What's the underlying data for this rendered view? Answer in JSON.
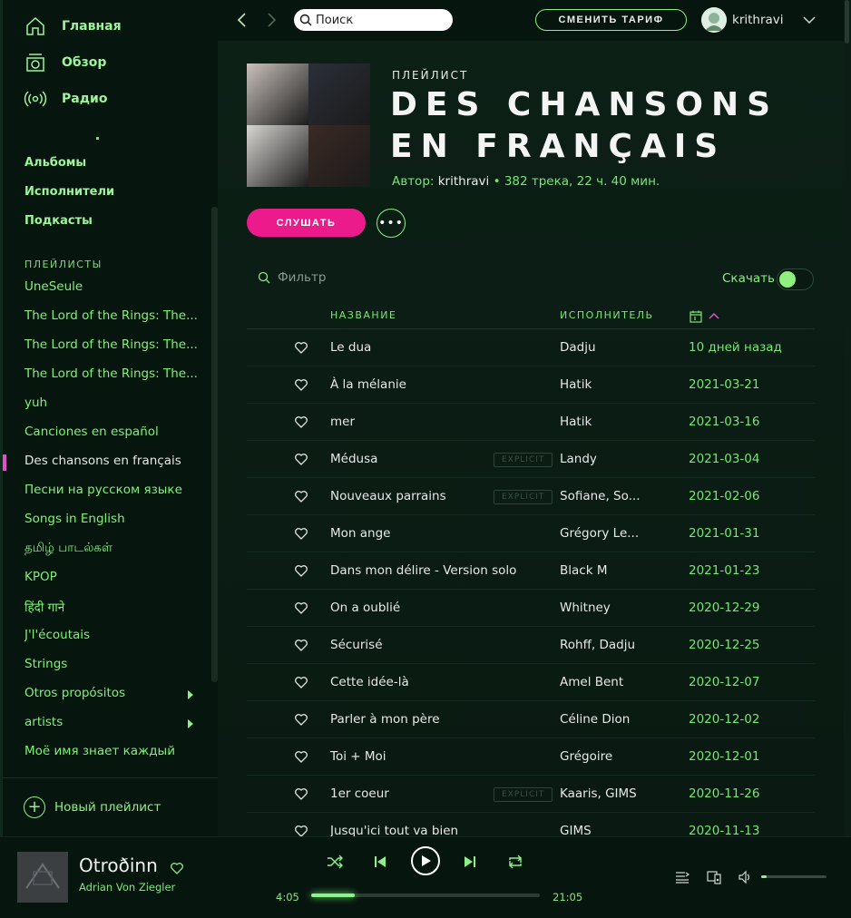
{
  "nav": {
    "home": "Главная",
    "browse": "Обзор",
    "radio": "Радио"
  },
  "library": {
    "albums": "Альбомы",
    "artists": "Исполнители",
    "podcasts": "Подкасты"
  },
  "playlists_label": "ПЛЕЙЛИСТЫ",
  "playlists": [
    {
      "label": "UneSeule"
    },
    {
      "label": "The Lord of the Rings: The..."
    },
    {
      "label": "The Lord of the Rings: The..."
    },
    {
      "label": "The Lord of the Rings: The..."
    },
    {
      "label": "yuh"
    },
    {
      "label": "Canciones en español"
    },
    {
      "label": "Des chansons en français",
      "active": true
    },
    {
      "label": "Песни на русском языке"
    },
    {
      "label": "Songs in English"
    },
    {
      "label": "தமிழ் பாடல்கள்"
    },
    {
      "label": "KPOP"
    },
    {
      "label": "हिंदी गाने"
    },
    {
      "label": "J'l'écoutais"
    },
    {
      "label": "Strings"
    },
    {
      "label": "Otros propósitos",
      "folder": true
    },
    {
      "label": "artists",
      "folder": true
    },
    {
      "label": "Моё имя знает каждый"
    }
  ],
  "new_playlist": "Новый плейлист",
  "topbar": {
    "search_placeholder": "Поиск",
    "upgrade": "СМЕНИТЬ ТАРИФ",
    "username": "krithravi"
  },
  "playlist": {
    "kicker": "ПЛЕЙЛИСТ",
    "title": "DES CHANSONS EN FRANÇAIS",
    "author_label": "Автор:",
    "owner": "krithravi",
    "meta_rest": "• 382 трека, 22 ч. 40 мин.",
    "play": "СЛУШАТЬ",
    "filter_placeholder": "Фильтр",
    "download_label": "Скачать",
    "download_on": true,
    "cover_colors": [
      "#c9c1bb",
      "#2a2f38",
      "#d8d6d2",
      "#3a2a24"
    ]
  },
  "columns": {
    "title": "НАЗВАНИЕ",
    "artist": "ИСПОЛНИТЕЛЬ"
  },
  "tracks": [
    {
      "title": "Le dua",
      "artist": "Dadju",
      "date": "10 дней назад",
      "explicit": false
    },
    {
      "title": "À la mélanie",
      "artist": "Hatik",
      "date": "2021-03-21",
      "explicit": false
    },
    {
      "title": "mer",
      "artist": "Hatik",
      "date": "2021-03-16",
      "explicit": false
    },
    {
      "title": "Médusa",
      "artist": "Landy",
      "date": "2021-03-04",
      "explicit": true
    },
    {
      "title": "Nouveaux parrains",
      "artist": "Sofiane, So...",
      "date": "2021-02-06",
      "explicit": true
    },
    {
      "title": "Mon ange",
      "artist": "Grégory Le...",
      "date": "2021-01-31",
      "explicit": false
    },
    {
      "title": "Dans mon délire - Version solo",
      "artist": "Black M",
      "date": "2021-01-23",
      "explicit": false
    },
    {
      "title": "On a oublié",
      "artist": "Whitney",
      "date": "2020-12-29",
      "explicit": false
    },
    {
      "title": "Sécurisé",
      "artist": "Rohff, Dadju",
      "date": "2020-12-25",
      "explicit": false
    },
    {
      "title": "Cette idée-là",
      "artist": "Amel Bent",
      "date": "2020-12-07",
      "explicit": false
    },
    {
      "title": "Parler à mon père",
      "artist": "Céline Dion",
      "date": "2020-12-02",
      "explicit": false
    },
    {
      "title": "Toi + Moi",
      "artist": "Grégoire",
      "date": "2020-12-01",
      "explicit": false
    },
    {
      "title": "1er coeur",
      "artist": "Kaaris, GIMS",
      "date": "2020-11-26",
      "explicit": true
    },
    {
      "title": "Jusqu'ici tout va bien",
      "artist": "GIMS",
      "date": "2020-11-13",
      "explicit": false
    }
  ],
  "explicit_label": "EXPLICIT",
  "player": {
    "track": "Otroðinn",
    "artist": "Adrian Von Ziegler",
    "elapsed": "4:05",
    "duration": "21:05",
    "progress_fraction": 0.19,
    "volume_fraction": 0.08
  },
  "colors": {
    "accent": "#8cf58a",
    "play_button": "#ec1b8c",
    "active_marker": "#e050c6"
  }
}
